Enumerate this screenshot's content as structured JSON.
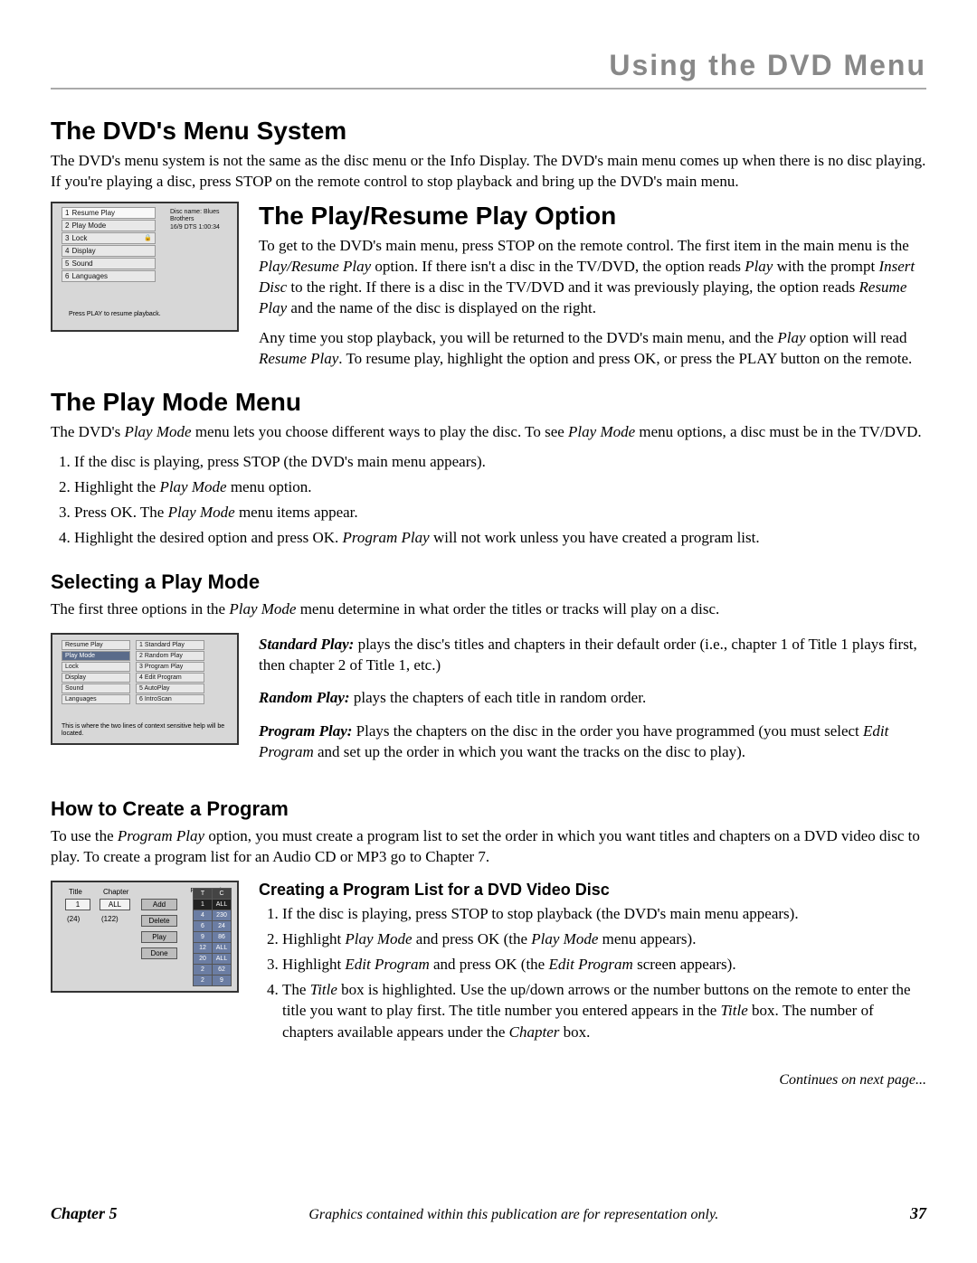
{
  "chapter": {
    "title": "Using the DVD Menu",
    "label": "Chapter 5",
    "page_number": "37",
    "footer_note": "Graphics contained within this publication are for representation only.",
    "continues": "Continues on next page..."
  },
  "sect_menu": {
    "heading": "The DVD's Menu System",
    "para": "The DVD's menu system is not the same as the disc menu or the Info Display. The DVD's main menu comes up when there is no disc playing. If you're playing a disc, press STOP on the remote control to stop playback and bring up the DVD's main menu."
  },
  "sect_playresume": {
    "heading": "The Play/Resume Play Option",
    "para1": "To get to the DVD's main menu, press STOP on the remote control. The first item in the main menu is the Play/Resume Play option. If there isn't a disc in the TV/DVD, the option reads Play with the prompt Insert Disc to the right. If there is a disc in the TV/DVD and it was previously playing, the option reads Resume Play and the name of the disc is displayed on the right.",
    "para2": "Any time you stop playback, you will be returned to the DVD's main menu, and the Play option will read Resume Play. To resume play, highlight the option and press OK, or press the PLAY button on the remote."
  },
  "fig_a": {
    "disc_line1": "Disc name: Blues Brothers",
    "disc_line2": "16/9 DTS  1:00:34",
    "items": [
      "Resume Play",
      "Play Mode",
      "Lock",
      "Display",
      "Sound",
      "Languages"
    ],
    "prompt": "Press PLAY to resume playback."
  },
  "sect_playmode": {
    "heading": "The Play Mode Menu",
    "para": "The DVD's Play Mode menu lets you choose different ways to play the disc. To see Play Mode menu options, a disc must be in the TV/DVD.",
    "steps": [
      "If the disc is playing, press STOP (the DVD's main menu appears).",
      "Highlight the Play Mode menu option.",
      "Press OK. The Play Mode menu items appear.",
      "Highlight the desired option and press OK. Program Play will not work unless you have created a program list."
    ]
  },
  "sect_selecting": {
    "heading": "Selecting a Play Mode",
    "para": "The first three options in the Play Mode menu determine in what order the titles or tracks will play on a disc.",
    "fig_left": [
      "Resume Play",
      "Play Mode",
      "Lock",
      "Display",
      "Sound",
      "Languages"
    ],
    "fig_right": [
      "Standard Play",
      "Random Play",
      "Program Play",
      "Edit Program",
      "AutoPlay",
      "IntroScan"
    ],
    "fig_caption": "This is where the two lines of context sensitive help will be located.",
    "std_label": "Standard Play:",
    "std_text": " plays the disc's titles and chapters in their default order (i.e., chapter 1 of Title 1 plays first, then chapter 2 of Title 1, etc.)",
    "rand_label": "Random Play:",
    "rand_text": " plays the chapters of each title in random order.",
    "prog_label": "Program Play:",
    "prog_text": "  Plays the chapters on the disc in the order you have programmed (you must select Edit Program and set up the order in which you want the tracks on the disc to play)."
  },
  "sect_create": {
    "heading": "How to Create a Program",
    "para": "To use the Program Play option, you must create a program list to set the order in which you want titles and chapters on a DVD video disc to play. To create a program list for an Audio CD or MP3 go to Chapter 7.",
    "sub_heading": "Creating a Program List for a DVD Video Disc",
    "steps": [
      "If the disc is playing, press STOP to stop playback (the DVD's main menu appears).",
      "Highlight Play Mode and press OK (the Play Mode menu appears).",
      "Highlight Edit Program and press OK (the Edit Program screen appears).",
      "The Title box is highlighted. Use the up/down arrows or the number buttons on the remote to enter the title you want to play first. The title number you entered appears in the Title box. The number of chapters available appears under the Chapter box."
    ]
  },
  "fig_c": {
    "title_lbl": "Title",
    "chapter_lbl": "Chapter",
    "proglist_lbl": "Program List",
    "title_val": "1",
    "chapter_val": "ALL",
    "title_total": "(24)",
    "chapter_total": "(122)",
    "btns": [
      "Add",
      "Delete",
      "Play",
      "Done"
    ],
    "pl_header": [
      "T",
      "C"
    ],
    "pl_rows": [
      [
        "1",
        "ALL"
      ],
      [
        "4",
        "230"
      ],
      [
        "6",
        "24"
      ],
      [
        "9",
        "86"
      ],
      [
        "12",
        "ALL"
      ],
      [
        "20",
        "ALL"
      ],
      [
        "2",
        "62"
      ],
      [
        "2",
        "9"
      ]
    ]
  }
}
